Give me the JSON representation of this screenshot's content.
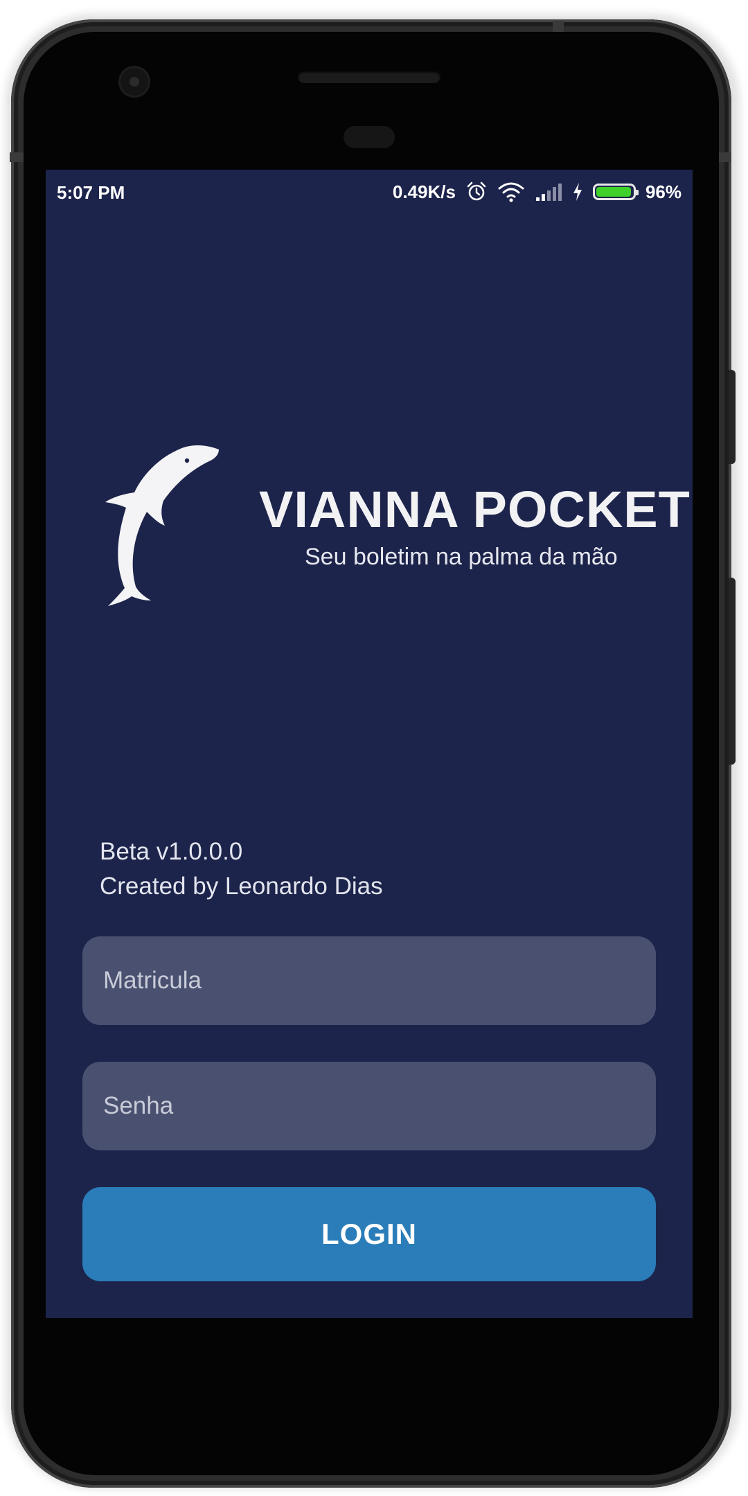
{
  "status_bar": {
    "time": "5:07 PM",
    "network_speed": "0.49K/s",
    "battery_percent": "96%",
    "battery_level": 0.96,
    "icons": [
      "alarm-icon",
      "wifi-icon",
      "signal-icon",
      "charging-icon",
      "battery-icon"
    ]
  },
  "app": {
    "logo_icon": "dolphin-icon",
    "title": "VIANNA POCKET",
    "subtitle": "Seu boletim na palma da mão",
    "version": "Beta v1.0.0.0",
    "author": "Created by Leonardo Dias"
  },
  "form": {
    "matricula_placeholder": "Matricula",
    "senha_placeholder": "Senha",
    "login_label": "LOGIN"
  },
  "colors": {
    "background": "#1d244b",
    "field": "#4a5170",
    "login_button": "#2a7db8",
    "battery_fill": "#3fd12a"
  }
}
